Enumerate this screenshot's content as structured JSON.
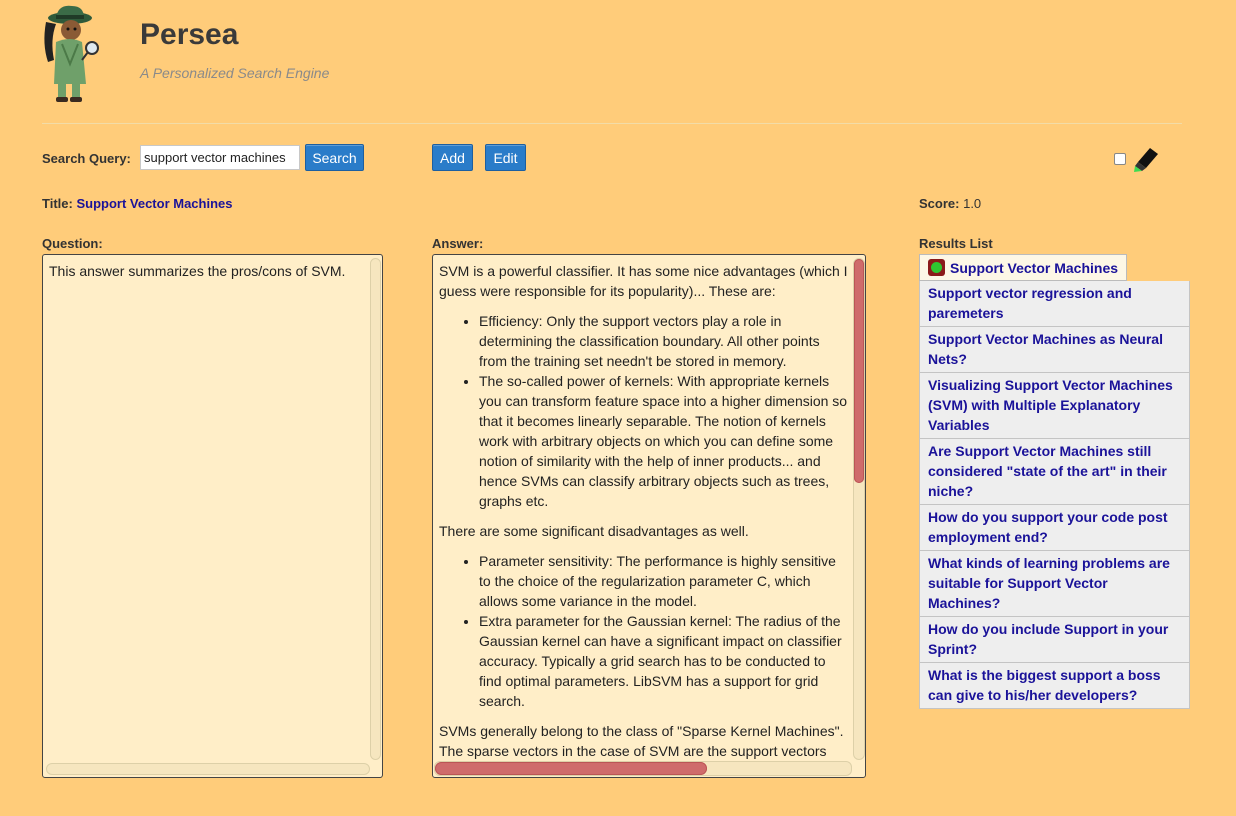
{
  "app": {
    "title": "Persea",
    "subtitle": "A Personalized Search Engine"
  },
  "search": {
    "label": "Search Query:",
    "value": "support vector machines",
    "button": "Search"
  },
  "toolbar": {
    "add": "Add",
    "edit": "Edit"
  },
  "document": {
    "title_label": "Title:",
    "title": "Support Vector Machines",
    "score_label": "Score:",
    "score": "1.0",
    "question_label": "Question:",
    "question": "This answer summarizes the pros/cons of SVM.",
    "answer_label": "Answer:",
    "answer": {
      "intro": "SVM is a powerful classifier. It has some nice advantages (which I guess were responsible for its popularity)... These are:",
      "advantages": [
        "Efficiency: Only the support vectors play a role in determining the classification boundary. All other points from the training set needn't be stored in memory.",
        "The so-called power of kernels: With appropriate kernels you can transform feature space into a higher dimension so that it becomes linearly separable. The notion of kernels work with arbitrary objects on which you can define some notion of similarity with the help of inner products... and hence SVMs can classify arbitrary objects such as trees, graphs etc."
      ],
      "middle": "There are some significant disadvantages as well.",
      "disadvantages": [
        "Parameter sensitivity: The performance is highly sensitive to the choice of the regularization parameter C, which allows some variance in the model.",
        "Extra parameter for the Gaussian kernel: The radius of the Gaussian kernel can have a significant impact on classifier accuracy. Typically a grid search has to be conducted to find optimal parameters. LibSVM has a support for grid search."
      ],
      "outro": "SVMs generally belong to the class of \"Sparse Kernel Machines\". The sparse vectors in the case of SVM are the support vectors"
    }
  },
  "results": {
    "label": "Results List",
    "items": [
      "Support Vector Machines",
      "Support vector regression and paremeters",
      "Support Vector Machines as Neural Nets?",
      "Visualizing Support Vector Machines (SVM) with Multiple Explanatory Variables",
      "Are Support Vector Machines still considered \"state of the art\" in their niche?",
      "How do you support your code post employment end?",
      "What kinds of learning problems are suitable for Support Vector Machines?",
      "How do you include Support in your Sprint?",
      "What is the biggest support a boss can give to his/her developers?"
    ]
  },
  "colors": {
    "background": "#ffcc7a",
    "button": "#2a7cc9",
    "link": "#1a1299",
    "scrollbar_thumb": "#cf6b6b"
  }
}
